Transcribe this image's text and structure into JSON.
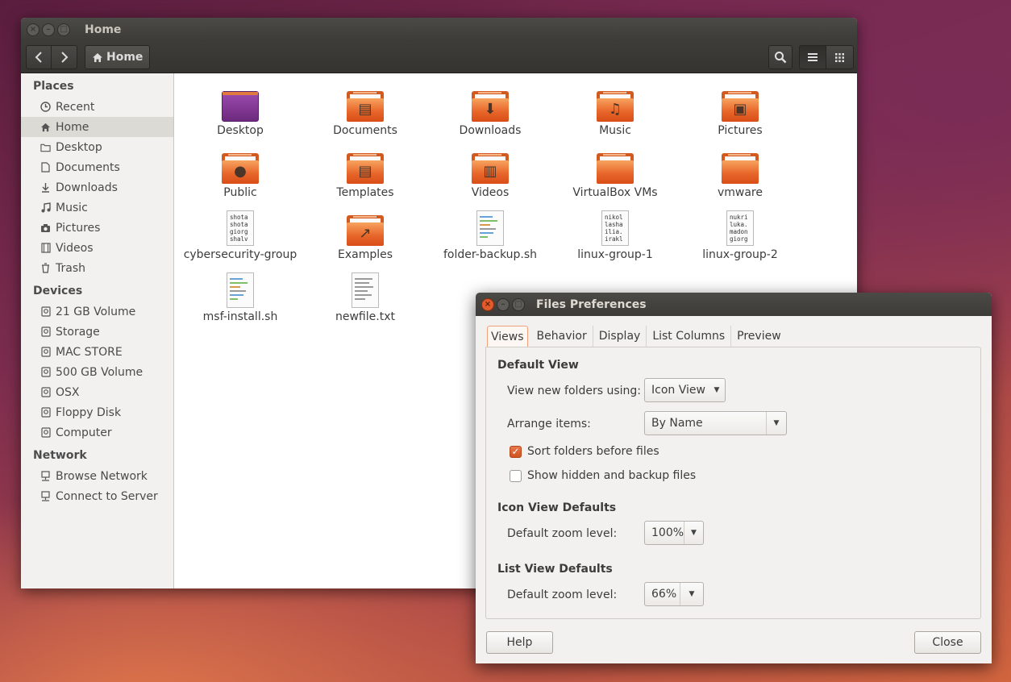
{
  "window": {
    "title": "Home",
    "breadcrumb": "Home"
  },
  "sidebar": {
    "places_title": "Places",
    "places": [
      {
        "label": "Recent",
        "icon": "clock-icon"
      },
      {
        "label": "Home",
        "icon": "home-icon",
        "active": true
      },
      {
        "label": "Desktop",
        "icon": "folder-icon"
      },
      {
        "label": "Documents",
        "icon": "document-icon"
      },
      {
        "label": "Downloads",
        "icon": "download-icon"
      },
      {
        "label": "Music",
        "icon": "music-icon"
      },
      {
        "label": "Pictures",
        "icon": "camera-icon"
      },
      {
        "label": "Videos",
        "icon": "film-icon"
      },
      {
        "label": "Trash",
        "icon": "trash-icon"
      }
    ],
    "devices_title": "Devices",
    "devices": [
      {
        "label": "21 GB Volume"
      },
      {
        "label": "Storage"
      },
      {
        "label": "MAC STORE"
      },
      {
        "label": "500 GB Volume"
      },
      {
        "label": "OSX"
      },
      {
        "label": "Floppy Disk"
      },
      {
        "label": "Computer"
      }
    ],
    "network_title": "Network",
    "network": [
      {
        "label": "Browse Network"
      },
      {
        "label": "Connect to Server"
      }
    ]
  },
  "files": [
    {
      "label": "Desktop",
      "kind": "desktop"
    },
    {
      "label": "Documents",
      "kind": "folder",
      "emblem": "documents"
    },
    {
      "label": "Downloads",
      "kind": "folder",
      "emblem": "download"
    },
    {
      "label": "Music",
      "kind": "folder",
      "emblem": "music"
    },
    {
      "label": "Pictures",
      "kind": "folder",
      "emblem": "pictures"
    },
    {
      "label": "Public",
      "kind": "folder",
      "emblem": "person"
    },
    {
      "label": "Templates",
      "kind": "folder",
      "emblem": "templates"
    },
    {
      "label": "Videos",
      "kind": "folder",
      "emblem": "film"
    },
    {
      "label": "VirtualBox VMs",
      "kind": "folder"
    },
    {
      "label": "vmware",
      "kind": "folder"
    },
    {
      "label": "cybersecurity-group",
      "kind": "text",
      "preview": [
        "shota",
        "shota",
        "giorg",
        "shalv"
      ]
    },
    {
      "label": "Examples",
      "kind": "folder",
      "emblem": "link"
    },
    {
      "label": "folder-backup.sh",
      "kind": "script"
    },
    {
      "label": "linux-group-1",
      "kind": "text",
      "preview": [
        "nikol",
        "lasha",
        "ilia.",
        "irakl"
      ]
    },
    {
      "label": "linux-group-2",
      "kind": "text",
      "preview": [
        "nukri",
        "luka.",
        "madon",
        "giorg"
      ]
    },
    {
      "label": "msf-install.sh",
      "kind": "script"
    },
    {
      "label": "newfile.txt",
      "kind": "plain"
    }
  ],
  "prefs": {
    "title": "Files Preferences",
    "tabs": [
      "Views",
      "Behavior",
      "Display",
      "List Columns",
      "Preview"
    ],
    "default_view_heading": "Default View",
    "view_new_label": "View new folders using:",
    "view_new_value": "Icon View",
    "arrange_label": "Arrange items:",
    "arrange_value": "By Name",
    "sort_folders_label": "Sort folders before files",
    "sort_folders_checked": true,
    "show_hidden_label": "Show hidden and backup files",
    "show_hidden_checked": false,
    "icon_view_heading": "Icon View Defaults",
    "icon_zoom_label": "Default zoom level:",
    "icon_zoom_value": "100%",
    "list_view_heading": "List View Defaults",
    "list_zoom_label": "Default zoom level:",
    "list_zoom_value": "66%",
    "help_label": "Help",
    "close_label": "Close",
    "accent_color": "#dd4814"
  }
}
